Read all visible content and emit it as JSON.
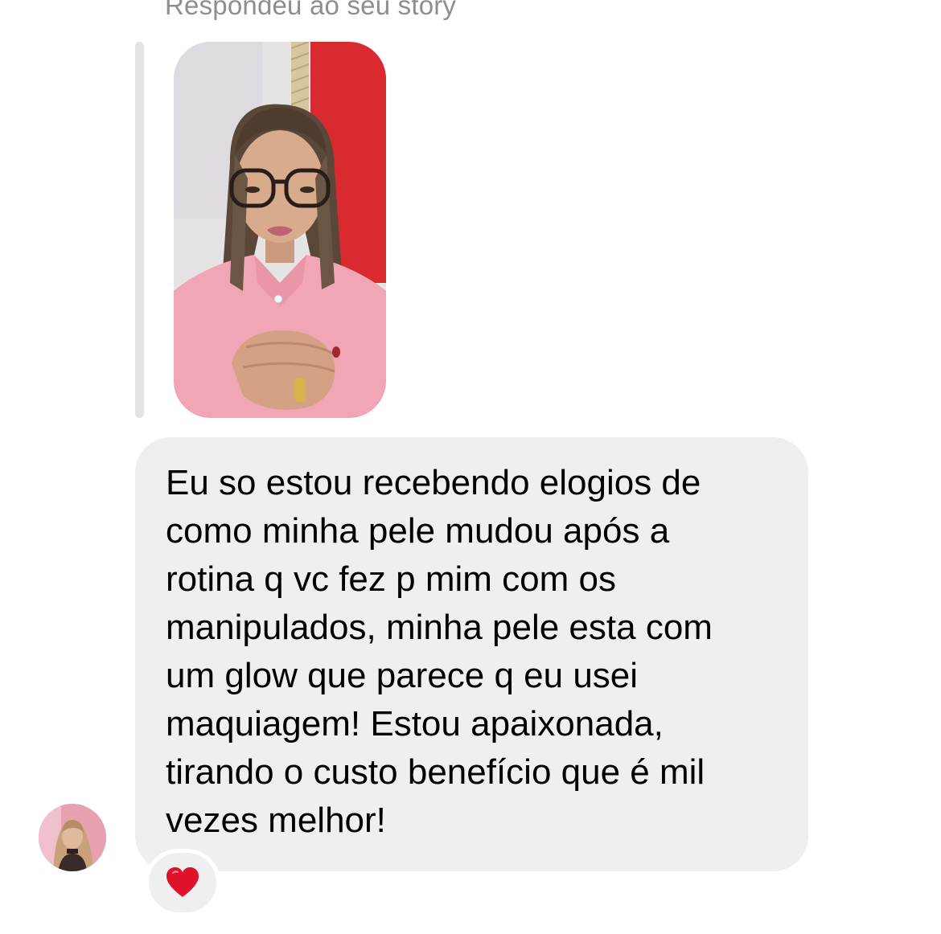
{
  "story_reply": {
    "label": "Respondeu ao seu story",
    "thumbnail_description": "story-photo"
  },
  "message": {
    "text": "Eu so estou recebendo elogios de\ncomo minha pele mudou após a\nrotina q vc fez p mim com os\nmanipulados, minha pele esta com\num glow que parece q eu usei\nmaquiagem! Estou apaixonada,\ntirando o custo benefício que é mil\nvezes melhor!",
    "bubble_color": "#efefef",
    "text_color": "#000000"
  },
  "sender": {
    "avatar_icon": "profile-avatar"
  },
  "reaction": {
    "icon": "heart-icon",
    "color": "#e0112b"
  },
  "colors": {
    "secondary_text": "#8e8e8e",
    "reply_bar": "#e4e4e4"
  }
}
